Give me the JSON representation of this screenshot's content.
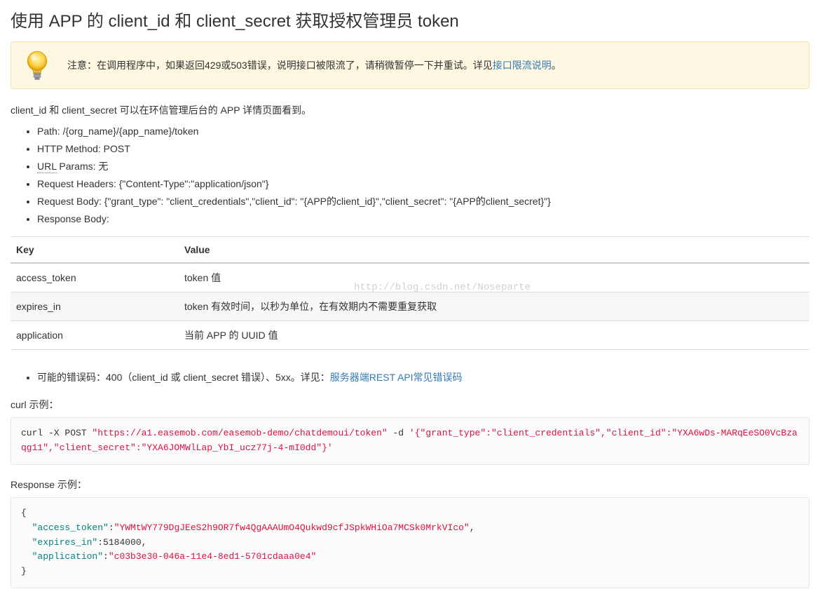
{
  "title": "使用 APP 的 client_id 和 client_secret 获取授权管理员 token",
  "notice": {
    "prefix": "注意：在调用程序中，如果返回429或503错误，说明接口被限流了，请稍微暂停一下并重试。详见",
    "link_text": "接口限流说明",
    "suffix": "。"
  },
  "intro": "client_id 和 client_secret 可以在环信管理后台的 APP 详情页面看到。",
  "details": [
    {
      "label": "Path",
      "value": "/{org_name}/{app_name}/token",
      "underline": false
    },
    {
      "label": "HTTP Method",
      "value": "POST",
      "underline": false
    },
    {
      "label": "URL",
      "value": "Params: 无",
      "underline": true
    },
    {
      "label": "Request Headers",
      "value": "{\"Content-Type\":\"application/json\"}",
      "underline": false
    },
    {
      "label": "Request Body",
      "value": "{\"grant_type\": \"client_credentials\",\"client_id\": \"{APP的client_id}\",\"client_secret\": \"{APP的client_secret}\"}",
      "underline": false
    },
    {
      "label": "Response Body",
      "value": "",
      "underline": false
    }
  ],
  "table": {
    "headers": [
      "Key",
      "Value"
    ],
    "rows": [
      [
        "access_token",
        "token 值"
      ],
      [
        "expires_in",
        "token 有效时间，以秒为单位，在有效期内不需要重复获取"
      ],
      [
        "application",
        "当前 APP 的 UUID 值"
      ]
    ]
  },
  "errcode": {
    "prefix": "可能的错误码：400（client_id 或 client_secret 错误）、5xx。详见：",
    "link_text": "服务器端REST API常见错误码"
  },
  "curl_label": "curl 示例：",
  "curl": {
    "cmd_prefix": "curl -X POST ",
    "url": "\"https://a1.easemob.com/easemob-demo/chatdemoui/token\"",
    "mid": " -d ",
    "body": "'{\"grant_type\":\"client_credentials\",\"client_id\":\"YXA6wDs-MARqEeSO0VcBzaqg11\",\"client_secret\":\"YXA6JOMWlLap_YbI_ucz77j-4-mI0dd\"}'"
  },
  "response_label": "Response 示例：",
  "response": {
    "open": "{",
    "k1": "\"access_token\"",
    "v1": "\"YWMtWY779DgJEeS2h9OR7fw4QgAAAUmO4Qukwd9cfJSpkWHiOa7MCSk0MrkVIco\"",
    "k2": "\"expires_in\"",
    "v2": "5184000",
    "k3": "\"application\"",
    "v3": "\"c03b3e30-046a-11e4-8ed1-5701cdaaa0e4\"",
    "close": "}"
  },
  "watermark": "http://blog.csdn.net/Noseparte"
}
